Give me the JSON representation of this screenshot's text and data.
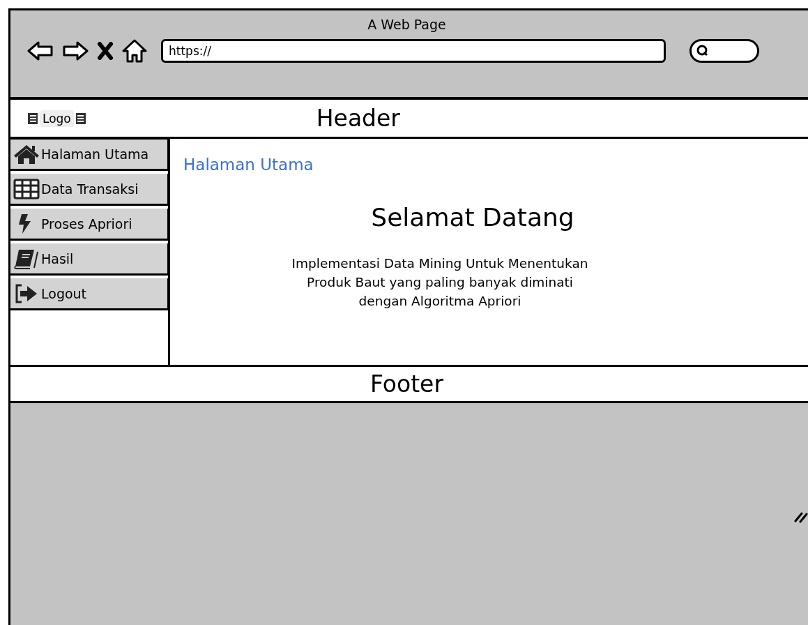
{
  "window": {
    "title": "A Web Page"
  },
  "address_bar": {
    "value": "https://"
  },
  "header": {
    "logo": "Logo",
    "title": "Header"
  },
  "sidebar": {
    "items": [
      {
        "label": "Halaman Utama"
      },
      {
        "label": "Data Transaksi"
      },
      {
        "label": "Proses Apriori"
      },
      {
        "label": "Hasil"
      },
      {
        "label": "Logout"
      }
    ]
  },
  "content": {
    "breadcrumb": "Halaman Utama",
    "heading": "Selamat Datang",
    "description": [
      "Implementasi Data Mining Untuk Menentukan",
      "Produk Baut yang paling banyak diminati",
      "dengan Algoritma Apriori"
    ]
  },
  "footer": {
    "title": "Footer"
  }
}
